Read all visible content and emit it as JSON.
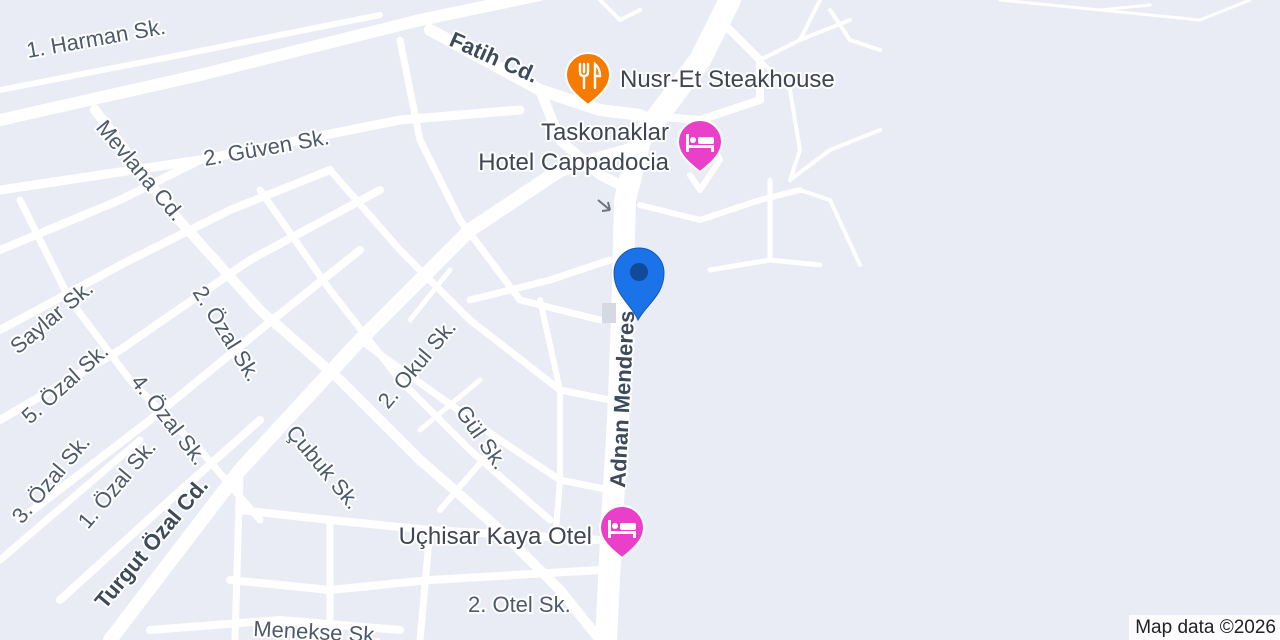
{
  "map": {
    "background_color": "#e9ecf5",
    "road_color": "#ffffff",
    "label_color": "#4e5a6b",
    "streets": [
      "1. Harman Sk.",
      "Fatih Cd.",
      "2. Güven Sk.",
      "Mevlana Cd.",
      "Saylar Sk.",
      "2. Özal Sk.",
      "5. Özal Sk.",
      "4. Özal Sk.",
      "3. Özal Sk.",
      "1. Özal Sk.",
      "Turgut Özal Cd.",
      "2. Okul Sk.",
      "Gül Sk.",
      "Çubuk Sk.",
      "Adnan Menderes",
      "2. Otel Sk.",
      "Menekse Sk."
    ],
    "pois": [
      {
        "name": "Nusr-Et Steakhouse",
        "category": "restaurant",
        "icon": "restaurant-icon",
        "color": "#f57c00"
      },
      {
        "name": "Taskonaklar\nHotel Cappadocia",
        "line1": "Taskonaklar",
        "line2": "Hotel Cappadocia",
        "category": "hotel",
        "icon": "hotel-bed-icon",
        "color": "#ea3fc8"
      },
      {
        "name": "Uçhisar Kaya Otel",
        "category": "hotel",
        "icon": "hotel-bed-icon",
        "color": "#ea3fc8"
      }
    ],
    "location_marker": {
      "icon": "location-pin-icon",
      "color": "#1a73e8"
    },
    "attribution": "Map data ©2026"
  }
}
